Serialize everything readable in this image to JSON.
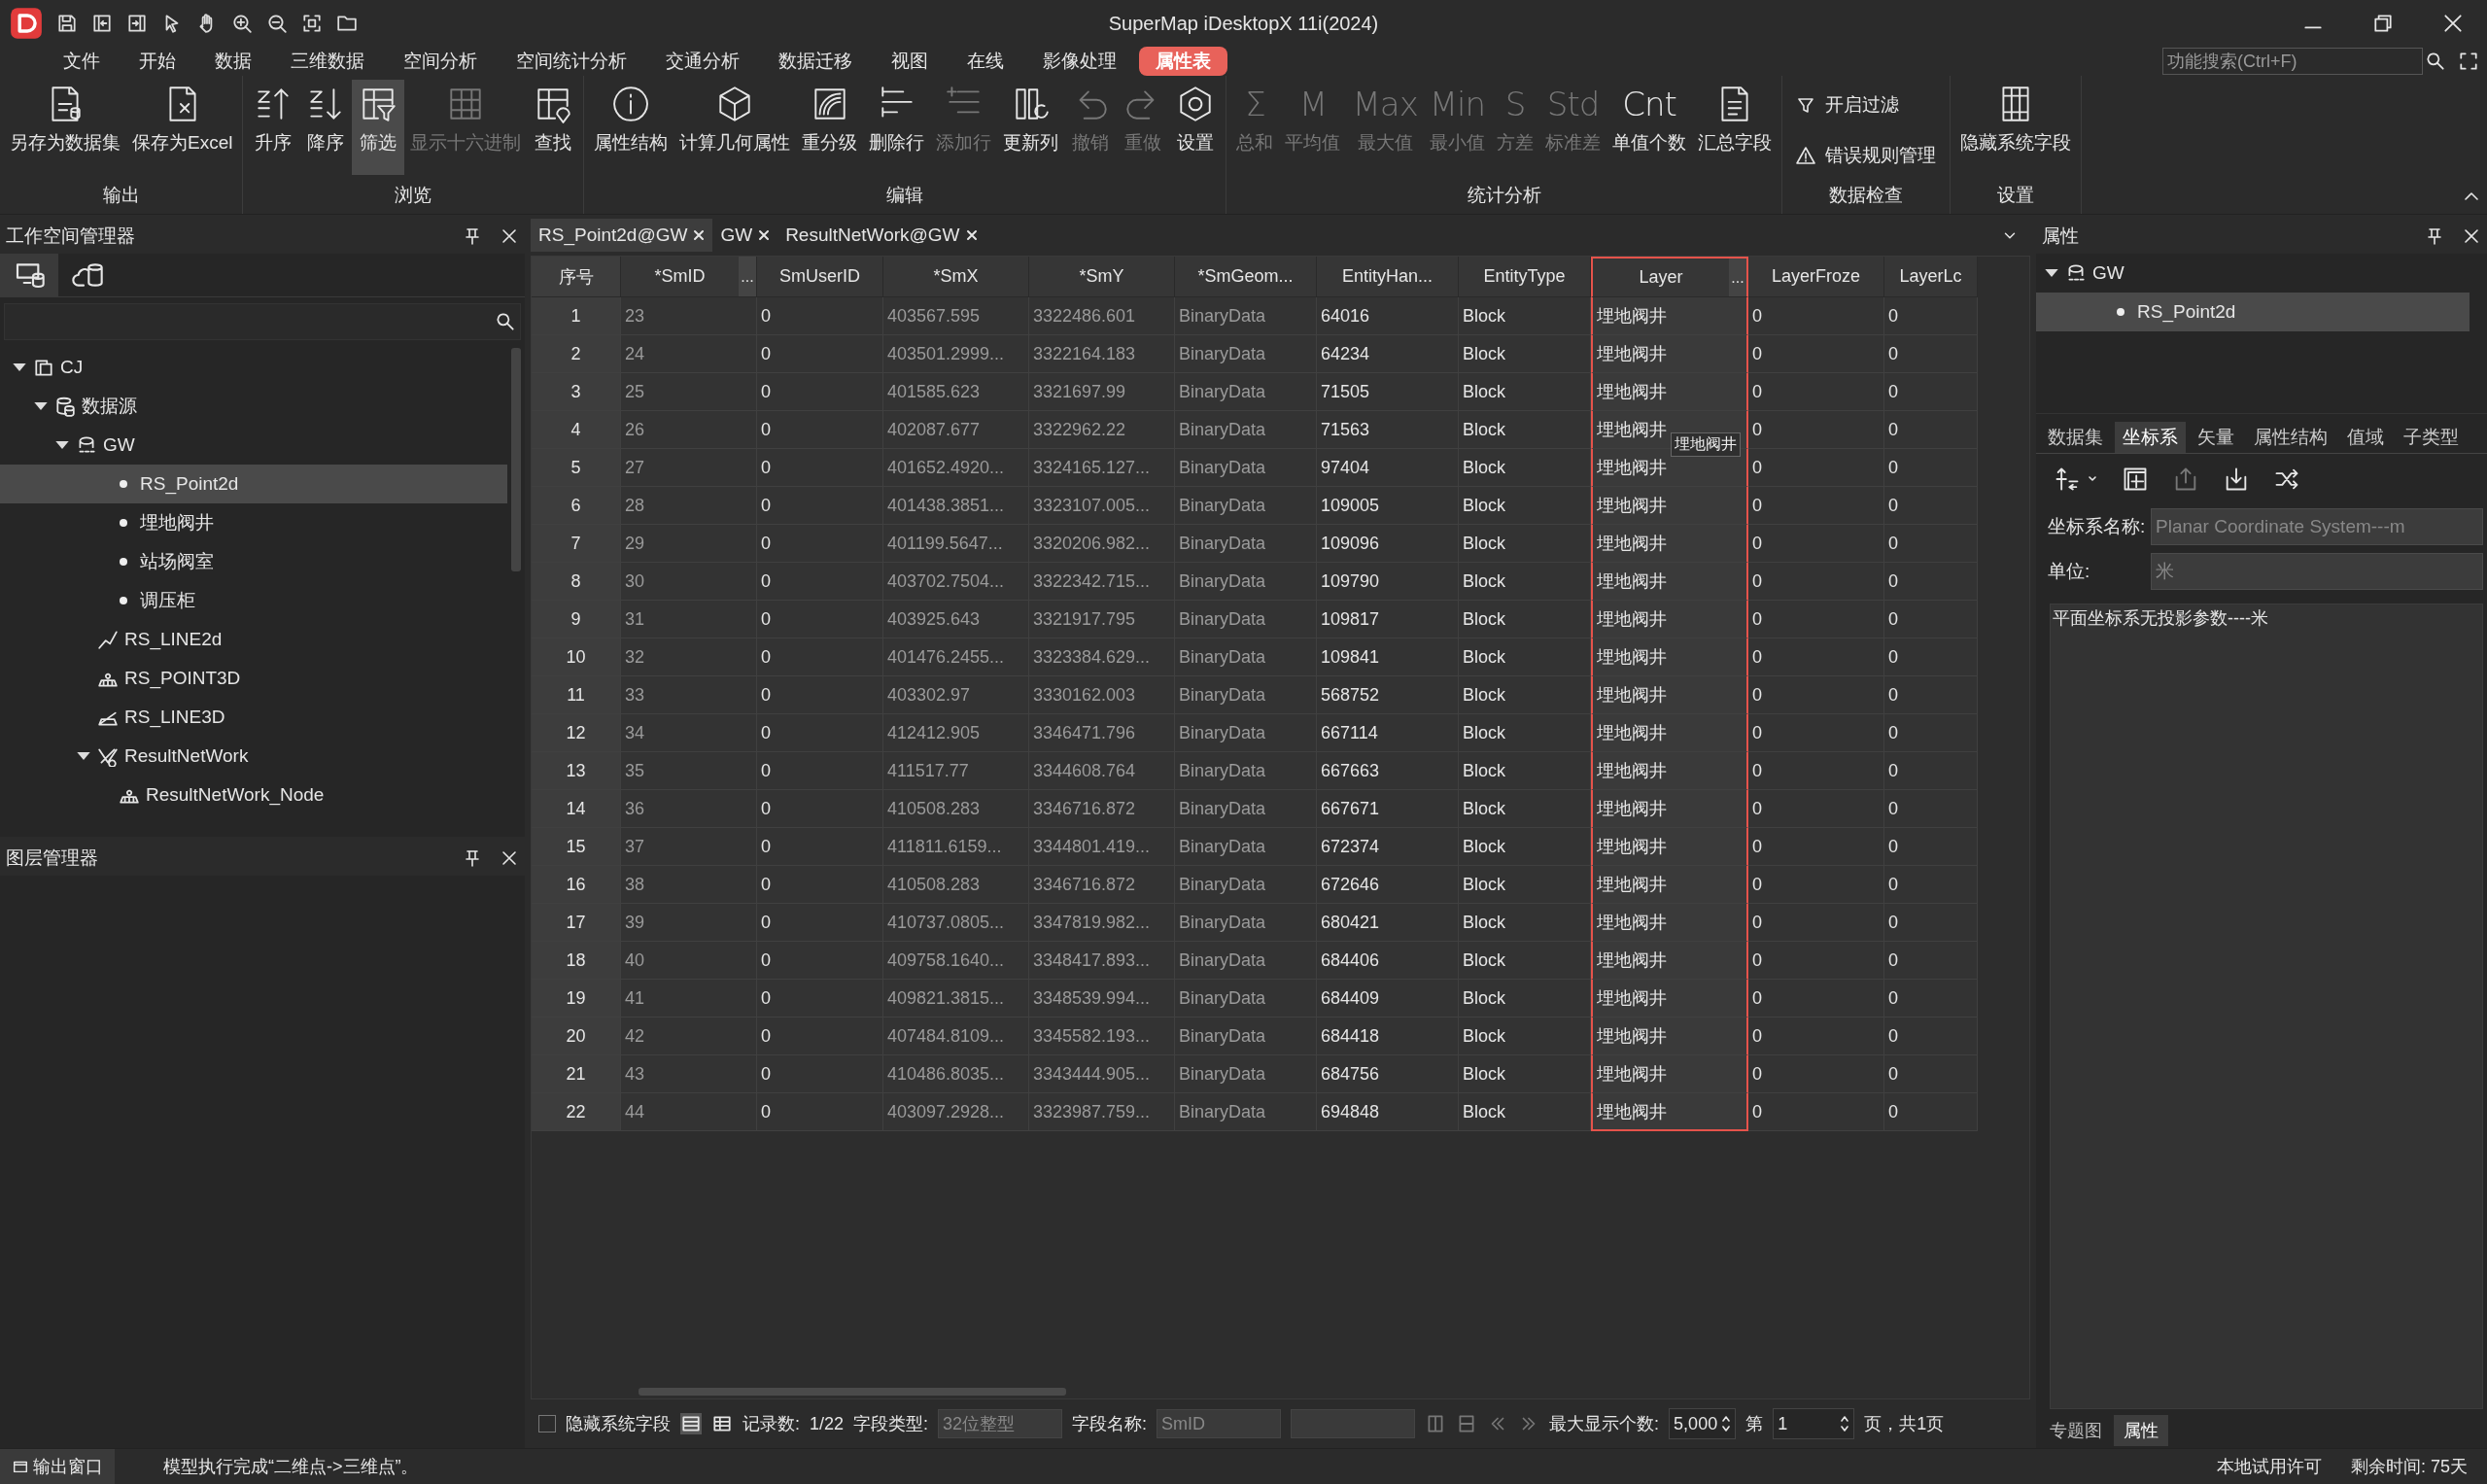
{
  "window": {
    "title": "SuperMap iDesktopX 11i(2024)"
  },
  "menu": [
    {
      "label": "文件",
      "selected": false
    },
    {
      "label": "开始",
      "selected": false
    },
    {
      "label": "数据",
      "selected": false
    },
    {
      "label": "三维数据",
      "selected": false
    },
    {
      "label": "空间分析",
      "selected": false
    },
    {
      "label": "空间统计分析",
      "selected": false
    },
    {
      "label": "交通分析",
      "selected": false
    },
    {
      "label": "数据迁移",
      "selected": false
    },
    {
      "label": "视图",
      "selected": false
    },
    {
      "label": "在线",
      "selected": false
    },
    {
      "label": "影像处理",
      "selected": false
    },
    {
      "label": "属性表",
      "selected": true
    }
  ],
  "search": {
    "placeholder": "功能搜索(Ctrl+F)"
  },
  "ribbon": [
    {
      "title": "输出",
      "items": [
        {
          "kind": "large",
          "label": "另存为数据集",
          "disabled": false,
          "selected": false
        },
        {
          "kind": "large",
          "label": "保存为Excel",
          "disabled": false,
          "selected": false
        }
      ]
    },
    {
      "title": "浏览",
      "items": [
        {
          "kind": "large",
          "label": "升序",
          "disabled": false,
          "selected": false
        },
        {
          "kind": "large",
          "label": "降序",
          "disabled": false,
          "selected": false
        },
        {
          "kind": "large",
          "label": "筛选",
          "disabled": false,
          "selected": true
        },
        {
          "kind": "large",
          "label": "显示十六进制",
          "disabled": true,
          "selected": false
        },
        {
          "kind": "large",
          "label": "查找",
          "disabled": false,
          "selected": false
        }
      ]
    },
    {
      "title": "编辑",
      "items": [
        {
          "kind": "large",
          "label": "属性结构",
          "disabled": false,
          "selected": false
        },
        {
          "kind": "large",
          "label": "计算几何属性",
          "disabled": false,
          "selected": false
        },
        {
          "kind": "large",
          "label": "重分级",
          "disabled": false,
          "selected": false
        },
        {
          "kind": "large",
          "label": "删除行",
          "disabled": false,
          "selected": false
        },
        {
          "kind": "large",
          "label": "添加行",
          "disabled": true,
          "selected": false
        },
        {
          "kind": "large",
          "label": "更新列",
          "disabled": false,
          "selected": false
        },
        {
          "kind": "large",
          "label": "撤销",
          "disabled": true,
          "selected": false
        },
        {
          "kind": "large",
          "label": "重做",
          "disabled": true,
          "selected": false
        },
        {
          "kind": "large",
          "label": "设置",
          "disabled": false,
          "selected": false
        }
      ]
    },
    {
      "title": "统计分析",
      "items": [
        {
          "kind": "glyph",
          "glyph": "Σ",
          "label": "总和",
          "disabled": true,
          "selected": false
        },
        {
          "kind": "glyph",
          "glyph": "M",
          "label": "平均值",
          "disabled": true,
          "selected": false
        },
        {
          "kind": "glyph",
          "glyph": "Max",
          "label": "最大值",
          "disabled": true,
          "selected": false
        },
        {
          "kind": "glyph",
          "glyph": "Min",
          "label": "最小值",
          "disabled": true,
          "selected": false
        },
        {
          "kind": "glyph",
          "glyph": "S",
          "label": "方差",
          "disabled": true,
          "selected": false
        },
        {
          "kind": "glyph",
          "glyph": "Std",
          "label": "标准差",
          "disabled": true,
          "selected": false
        },
        {
          "kind": "glyph",
          "glyph": "Cnt",
          "label": "单值个数",
          "disabled": false,
          "selected": false
        },
        {
          "kind": "large",
          "label": "汇总字段",
          "disabled": false,
          "selected": false
        }
      ]
    },
    {
      "title": "数据检查",
      "items": [
        {
          "kind": "small",
          "label": "开启过滤",
          "disabled": false
        },
        {
          "kind": "small",
          "label": "错误规则管理",
          "disabled": false
        }
      ]
    },
    {
      "title": "设置",
      "items": [
        {
          "kind": "large",
          "label": "隐藏系统字段",
          "disabled": false,
          "selected": false
        }
      ]
    }
  ],
  "workspace_panel": {
    "title": "工作空间管理器",
    "tabs": [
      {
        "selected": true
      },
      {
        "selected": false
      }
    ],
    "tree": [
      {
        "label": "CJ",
        "kind": "workspace",
        "expanded": true,
        "selected": false,
        "children": [
          {
            "label": "数据源",
            "kind": "datasources",
            "expanded": true,
            "selected": false,
            "children": [
              {
                "label": "GW",
                "kind": "datasource",
                "expanded": true,
                "selected": false,
                "children": [
                  {
                    "label": "RS_Point2d",
                    "kind": "point",
                    "selected": true
                  },
                  {
                    "label": "埋地阀井",
                    "kind": "point",
                    "selected": false
                  },
                  {
                    "label": "站场阀室",
                    "kind": "point",
                    "selected": false
                  },
                  {
                    "label": "调压柜",
                    "kind": "point",
                    "selected": false
                  },
                  {
                    "label": "RS_LINE2d",
                    "kind": "line",
                    "selected": false
                  },
                  {
                    "label": "RS_POINT3D",
                    "kind": "point3d",
                    "selected": false
                  },
                  {
                    "label": "RS_LINE3D",
                    "kind": "line3d",
                    "selected": false
                  },
                  {
                    "label": "ResultNetWork",
                    "kind": "network",
                    "expanded": true,
                    "selected": false,
                    "children": [
                      {
                        "label": "ResultNetWork_Node",
                        "kind": "point3d",
                        "selected": false
                      }
                    ]
                  }
                ]
              }
            ]
          }
        ]
      }
    ]
  },
  "layer_panel": {
    "title": "图层管理器"
  },
  "doc_tabs": [
    {
      "label": "RS_Point2d@GW",
      "selected": true
    },
    {
      "label": "GW",
      "selected": false
    },
    {
      "label": "ResultNetWork@GW",
      "selected": false
    }
  ],
  "table": {
    "columns": [
      {
        "label": "序号",
        "dimmed": false,
        "selected": false
      },
      {
        "label": "*SmID",
        "more": "...",
        "dimmed": true,
        "selected": false
      },
      {
        "label": "SmUserID",
        "dimmed": false,
        "selected": false
      },
      {
        "label": "*SmX",
        "dimmed": true,
        "selected": false
      },
      {
        "label": "*SmY",
        "dimmed": true,
        "selected": false
      },
      {
        "label": "*SmGeom...",
        "dimmed": true,
        "selected": false
      },
      {
        "label": "EntityHan...",
        "dimmed": false,
        "selected": false
      },
      {
        "label": "EntityType",
        "dimmed": false,
        "selected": false
      },
      {
        "label": "Layer",
        "more": "...",
        "dimmed": false,
        "selected": true
      },
      {
        "label": "LayerFroze",
        "dimmed": false,
        "selected": false
      },
      {
        "label": "LayerLc",
        "dimmed": false,
        "selected": false
      }
    ],
    "rows": [
      [
        "1",
        "23",
        "0",
        "403567.595",
        "3322486.601",
        "BinaryData",
        "64016",
        "Block",
        "埋地阀井",
        "0",
        "0"
      ],
      [
        "2",
        "24",
        "0",
        "403501.2999...",
        "3322164.183",
        "BinaryData",
        "64234",
        "Block",
        "埋地阀井",
        "0",
        "0"
      ],
      [
        "3",
        "25",
        "0",
        "401585.623",
        "3321697.99",
        "BinaryData",
        "71505",
        "Block",
        "埋地阀井",
        "0",
        "0"
      ],
      [
        "4",
        "26",
        "0",
        "402087.677",
        "3322962.22",
        "BinaryData",
        "71563",
        "Block",
        "埋地阀井",
        "0",
        "0"
      ],
      [
        "5",
        "27",
        "0",
        "401652.4920...",
        "3324165.127...",
        "BinaryData",
        "97404",
        "Block",
        "埋地阀井",
        "0",
        "0"
      ],
      [
        "6",
        "28",
        "0",
        "401438.3851...",
        "3323107.005...",
        "BinaryData",
        "109005",
        "Block",
        "埋地阀井",
        "0",
        "0"
      ],
      [
        "7",
        "29",
        "0",
        "401199.5647...",
        "3320206.982...",
        "BinaryData",
        "109096",
        "Block",
        "埋地阀井",
        "0",
        "0"
      ],
      [
        "8",
        "30",
        "0",
        "403702.7504...",
        "3322342.715...",
        "BinaryData",
        "109790",
        "Block",
        "埋地阀井",
        "0",
        "0"
      ],
      [
        "9",
        "31",
        "0",
        "403925.643",
        "3321917.795",
        "BinaryData",
        "109817",
        "Block",
        "埋地阀井",
        "0",
        "0"
      ],
      [
        "10",
        "32",
        "0",
        "401476.2455...",
        "3323384.629...",
        "BinaryData",
        "109841",
        "Block",
        "埋地阀井",
        "0",
        "0"
      ],
      [
        "11",
        "33",
        "0",
        "403302.97",
        "3330162.003",
        "BinaryData",
        "568752",
        "Block",
        "埋地阀井",
        "0",
        "0"
      ],
      [
        "12",
        "34",
        "0",
        "412412.905",
        "3346471.796",
        "BinaryData",
        "667114",
        "Block",
        "埋地阀井",
        "0",
        "0"
      ],
      [
        "13",
        "35",
        "0",
        "411517.77",
        "3344608.764",
        "BinaryData",
        "667663",
        "Block",
        "埋地阀井",
        "0",
        "0"
      ],
      [
        "14",
        "36",
        "0",
        "410508.283",
        "3346716.872",
        "BinaryData",
        "667671",
        "Block",
        "埋地阀井",
        "0",
        "0"
      ],
      [
        "15",
        "37",
        "0",
        "411811.6159...",
        "3344801.419...",
        "BinaryData",
        "672374",
        "Block",
        "埋地阀井",
        "0",
        "0"
      ],
      [
        "16",
        "38",
        "0",
        "410508.283",
        "3346716.872",
        "BinaryData",
        "672646",
        "Block",
        "埋地阀井",
        "0",
        "0"
      ],
      [
        "17",
        "39",
        "0",
        "410737.0805...",
        "3347819.982...",
        "BinaryData",
        "680421",
        "Block",
        "埋地阀井",
        "0",
        "0"
      ],
      [
        "18",
        "40",
        "0",
        "409758.1640...",
        "3348417.893...",
        "BinaryData",
        "684406",
        "Block",
        "埋地阀井",
        "0",
        "0"
      ],
      [
        "19",
        "41",
        "0",
        "409821.3815...",
        "3348539.994...",
        "BinaryData",
        "684409",
        "Block",
        "埋地阀井",
        "0",
        "0"
      ],
      [
        "20",
        "42",
        "0",
        "407484.8109...",
        "3345582.193...",
        "BinaryData",
        "684418",
        "Block",
        "埋地阀井",
        "0",
        "0"
      ],
      [
        "21",
        "43",
        "0",
        "410486.8035...",
        "3343444.905...",
        "BinaryData",
        "684756",
        "Block",
        "埋地阀井",
        "0",
        "0"
      ],
      [
        "22",
        "44",
        "0",
        "403097.2928...",
        "3323987.759...",
        "BinaryData",
        "694848",
        "Block",
        "埋地阀井",
        "0",
        "0"
      ]
    ],
    "tooltip": "埋地阀井"
  },
  "table_footer": {
    "hide_system_fields": {
      "label": "隐藏系统字段",
      "checked": false
    },
    "record_label": "记录数:",
    "record_value": "1/22",
    "field_type_label": "字段类型:",
    "field_type_value": "32位整型",
    "field_name_label": "字段名称:",
    "field_name_value": "SmID",
    "max_label": "最大显示个数:",
    "max_value": "5,000",
    "page_label": "第",
    "page_value": "1",
    "page_suffix": "页，共1页"
  },
  "properties_panel": {
    "title": "属性",
    "tree": [
      {
        "label": "GW",
        "kind": "datasource",
        "expanded": true,
        "selected": false,
        "children": [
          {
            "label": "RS_Point2d",
            "kind": "point",
            "selected": true
          }
        ]
      }
    ],
    "tabs": [
      {
        "label": "数据集",
        "selected": false
      },
      {
        "label": "坐标系",
        "selected": true
      },
      {
        "label": "矢量",
        "selected": false
      },
      {
        "label": "属性结构",
        "selected": false
      },
      {
        "label": "值域",
        "selected": false
      },
      {
        "label": "子类型",
        "selected": false
      }
    ],
    "name_label": "坐标系名称:",
    "name_value": "Planar Coordinate System---m",
    "unit_label": "单位:",
    "unit_value": "米",
    "description": "平面坐标系无投影参数----米"
  },
  "bottom_tabs": [
    {
      "label": "专题图",
      "selected": false
    },
    {
      "label": "属性",
      "selected": true
    }
  ],
  "status_bar": {
    "button": "输出窗口",
    "message": "模型执行完成“二维点->三维点”。",
    "license": "本地试用许可",
    "remaining": "剩余时间: 75天"
  }
}
